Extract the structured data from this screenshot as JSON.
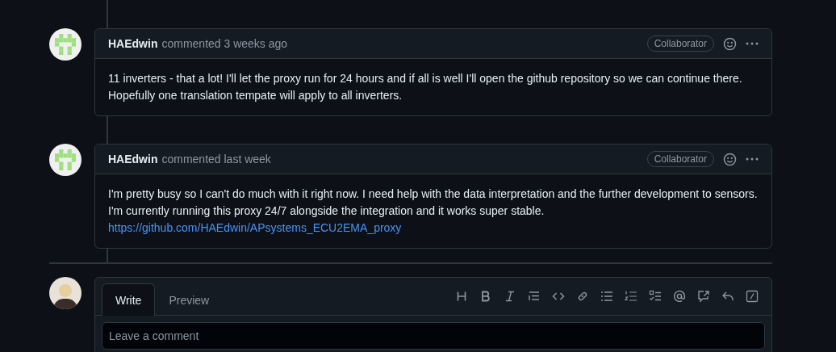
{
  "comments": [
    {
      "author": "HAEdwin",
      "meta": "commented 3 weeks ago",
      "badge": "Collaborator",
      "text": "11 inverters - that a lot! I'll let the proxy run for 24 hours and if all is well I'll open the github repository so we can continue there. Hopefully one translation tempate will apply to all inverters."
    },
    {
      "author": "HAEdwin",
      "meta": "commented last week",
      "badge": "Collaborator",
      "text": "I'm pretty busy so I can't do much with it right now. I need help with the data interpretation and the further development to sensors. I'm currently running this proxy 24/7 alongside the integration and it works super stable.",
      "link": "https://github.com/HAEdwin/APsystems_ECU2EMA_proxy"
    }
  ],
  "composer": {
    "tabs": [
      {
        "label": "Write",
        "selected": true
      },
      {
        "label": "Preview",
        "selected": false
      }
    ],
    "placeholder": "Leave a comment"
  }
}
